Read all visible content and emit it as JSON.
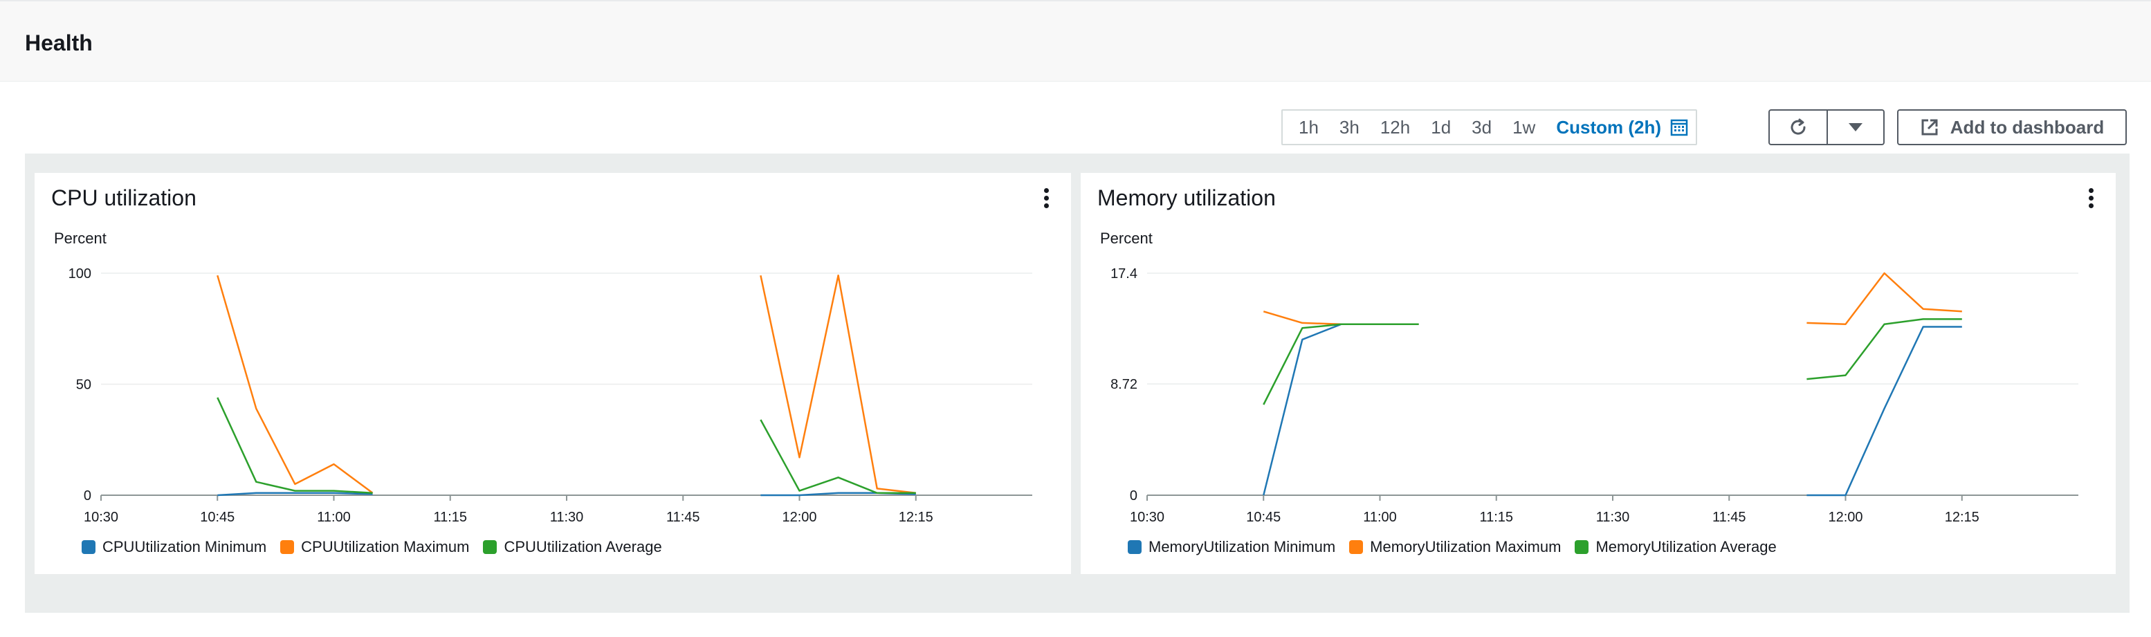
{
  "page": {
    "title": "Health"
  },
  "time_range": {
    "options": [
      "1h",
      "3h",
      "12h",
      "1d",
      "3d",
      "1w"
    ],
    "active": "Custom (2h)"
  },
  "toolbar": {
    "refresh_icon": "refresh-icon",
    "dropdown_icon": "caret-down-icon",
    "add_label": "Add to dashboard",
    "add_icon": "external-link-icon"
  },
  "colors": {
    "minimum": "#1f77b4",
    "maximum": "#ff7f0e",
    "average": "#2ca02c",
    "accent": "#0073bb"
  },
  "chart_data": [
    {
      "type": "line",
      "title": "CPU utilization",
      "ylabel": "Percent",
      "xlabel": "",
      "x_ticks": [
        "10:30",
        "10:45",
        "11:00",
        "11:15",
        "11:30",
        "11:45",
        "12:00",
        "12:15"
      ],
      "y_ticks": [
        "0",
        "50",
        "100"
      ],
      "ylim": [
        0,
        100
      ],
      "xlim": [
        "10:30",
        "12:30"
      ],
      "grid": true,
      "legend_position": "bottom-left",
      "series": [
        {
          "name": "CPUUtilization Minimum",
          "segments": [
            [
              [
                "10:45",
                0
              ],
              [
                "10:50",
                1
              ],
              [
                "10:55",
                1
              ],
              [
                "11:00",
                1
              ],
              [
                "11:05",
                0.5
              ]
            ],
            [
              [
                "11:55",
                0
              ],
              [
                "12:00",
                0
              ],
              [
                "12:05",
                1
              ],
              [
                "12:10",
                1
              ],
              [
                "12:15",
                0.5
              ]
            ]
          ]
        },
        {
          "name": "CPUUtilization Maximum",
          "segments": [
            [
              [
                "10:45",
                99
              ],
              [
                "10:50",
                39
              ],
              [
                "10:55",
                5
              ],
              [
                "11:00",
                14
              ],
              [
                "11:05",
                1
              ]
            ],
            [
              [
                "11:55",
                99
              ],
              [
                "12:00",
                17
              ],
              [
                "12:05",
                99
              ],
              [
                "12:10",
                3
              ],
              [
                "12:15",
                1
              ]
            ]
          ]
        },
        {
          "name": "CPUUtilization Average",
          "segments": [
            [
              [
                "10:45",
                44
              ],
              [
                "10:50",
                6
              ],
              [
                "10:55",
                2
              ],
              [
                "11:00",
                2
              ],
              [
                "11:05",
                1
              ]
            ],
            [
              [
                "11:55",
                34
              ],
              [
                "12:00",
                2
              ],
              [
                "12:05",
                8
              ],
              [
                "12:10",
                1
              ],
              [
                "12:15",
                1
              ]
            ]
          ]
        }
      ]
    },
    {
      "type": "line",
      "title": "Memory utilization",
      "ylabel": "Percent",
      "xlabel": "",
      "x_ticks": [
        "10:30",
        "10:45",
        "11:00",
        "11:15",
        "11:30",
        "11:45",
        "12:00",
        "12:15"
      ],
      "y_ticks": [
        "0",
        "8.72",
        "17.4"
      ],
      "ylim": [
        0,
        17.4
      ],
      "xlim": [
        "10:30",
        "12:30"
      ],
      "grid": true,
      "legend_position": "bottom-left",
      "series": [
        {
          "name": "MemoryUtilization Minimum",
          "segments": [
            [
              [
                "10:45",
                0
              ],
              [
                "10:50",
                12.2
              ],
              [
                "10:55",
                13.4
              ],
              [
                "11:00",
                13.4
              ],
              [
                "11:05",
                13.4
              ]
            ],
            [
              [
                "11:55",
                0
              ],
              [
                "12:00",
                0
              ],
              [
                "12:05",
                6.8
              ],
              [
                "12:10",
                13.2
              ],
              [
                "12:15",
                13.2
              ]
            ]
          ]
        },
        {
          "name": "MemoryUtilization Maximum",
          "segments": [
            [
              [
                "10:45",
                14.4
              ],
              [
                "10:50",
                13.5
              ],
              [
                "10:55",
                13.4
              ],
              [
                "11:00",
                13.4
              ],
              [
                "11:05",
                13.4
              ]
            ],
            [
              [
                "11:55",
                13.5
              ],
              [
                "12:00",
                13.4
              ],
              [
                "12:05",
                17.4
              ],
              [
                "12:10",
                14.6
              ],
              [
                "12:15",
                14.4
              ]
            ]
          ]
        },
        {
          "name": "MemoryUtilization Average",
          "segments": [
            [
              [
                "10:45",
                7.1
              ],
              [
                "10:50",
                13.1
              ],
              [
                "10:55",
                13.4
              ],
              [
                "11:00",
                13.4
              ],
              [
                "11:05",
                13.4
              ]
            ],
            [
              [
                "11:55",
                9.1
              ],
              [
                "12:00",
                9.4
              ],
              [
                "12:05",
                13.4
              ],
              [
                "12:10",
                13.8
              ],
              [
                "12:15",
                13.8
              ]
            ]
          ]
        }
      ]
    }
  ]
}
